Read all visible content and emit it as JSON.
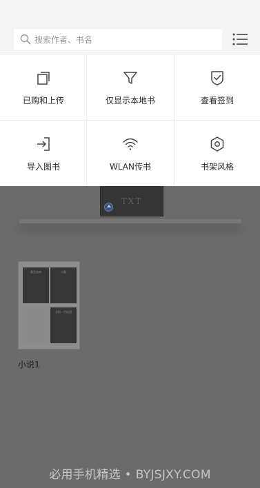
{
  "search": {
    "placeholder": "搜索作者、书名"
  },
  "quick_menu": [
    {
      "label": "已购和上传",
      "icon": "copy-icon"
    },
    {
      "label": "仅显示本地书",
      "icon": "filter-icon"
    },
    {
      "label": "查看签到",
      "icon": "shield-check-icon"
    },
    {
      "label": "导入图书",
      "icon": "import-icon"
    },
    {
      "label": "WLAN传书",
      "icon": "wifi-icon"
    },
    {
      "label": "书架风格",
      "icon": "gear-icon"
    }
  ],
  "shelf": {
    "book_cover_text": "TXT",
    "folder": {
      "label": "小说1",
      "mini_covers": [
        "重生仙帝",
        "斗破",
        "",
        "全职一世仙途"
      ]
    }
  },
  "watermark": "必用手机精选 • BYJSJXY.COM",
  "colors": {
    "overlay": "#6b6b6b",
    "panel": "#ffffff",
    "search_bg": "#f4f4f4",
    "icon": "#444444"
  }
}
